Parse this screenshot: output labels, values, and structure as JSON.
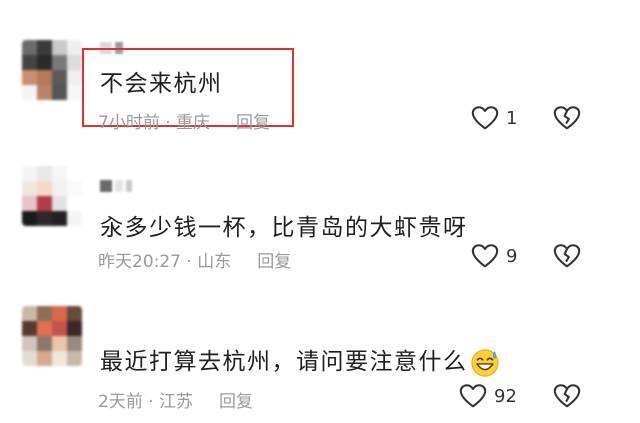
{
  "comments": [
    {
      "text": "不会来杭州",
      "time": "7小时前",
      "location": "重庆",
      "reply_label": "回复",
      "like_count": "1"
    },
    {
      "text": "汆多少钱一杯，比青岛的大虾贵呀",
      "time": "昨天20:27",
      "location": "山东",
      "reply_label": "回复",
      "like_count": "9"
    },
    {
      "text": "最近打算去杭州，请问要注意什么",
      "time": "2天前",
      "location": "江苏",
      "reply_label": "回复",
      "like_count": "92",
      "emoji": "grinning-sweat-emoji"
    }
  ],
  "meta_separator": " · ",
  "icons": {
    "like": "heart-outline-icon",
    "dislike": "broken-heart-icon"
  },
  "colors": {
    "highlight_border": "#e03030",
    "meta_text": "#9a9a9a"
  }
}
